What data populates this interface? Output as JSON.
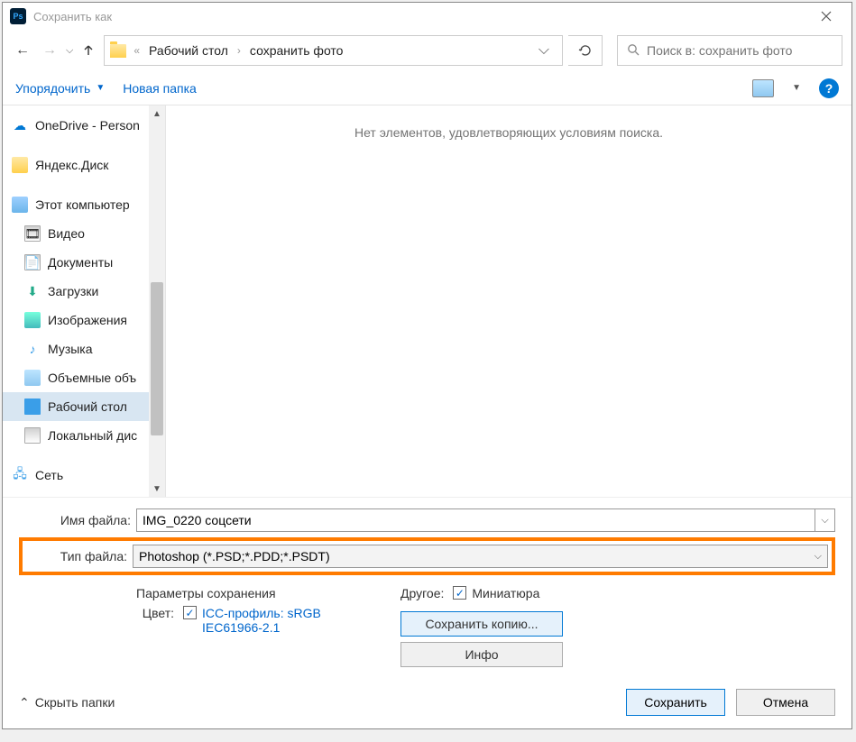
{
  "title": "Сохранить как",
  "app_icon_text": "Ps",
  "breadcrumb": {
    "prefix": "«",
    "seg1": "Рабочий стол",
    "seg2": "сохранить фото"
  },
  "search": {
    "placeholder": "Поиск в: сохранить фото"
  },
  "toolbar": {
    "organize": "Упорядочить",
    "newfolder": "Новая папка",
    "help_glyph": "?"
  },
  "sidebar": {
    "onedrive": "OneDrive - Person",
    "ydisk": "Яндекс.Диск",
    "thispc": "Этот компьютер",
    "video": "Видео",
    "docs": "Документы",
    "downloads": "Загрузки",
    "images": "Изображения",
    "music": "Музыка",
    "volumes": "Объемные объ",
    "desktop": "Рабочий стол",
    "localdisk": "Локальный дис",
    "network": "Сеть"
  },
  "main": {
    "empty": "Нет элементов, удовлетворяющих условиям поиска."
  },
  "fields": {
    "filename_label": "Имя файла:",
    "filename_value": "IMG_0220 соцсети",
    "filetype_label": "Тип файла:",
    "filetype_value": "Photoshop (*.PSD;*.PDD;*.PSDT)"
  },
  "options": {
    "save_params": "Параметры сохранения",
    "color_label": "Цвет:",
    "icc_profile": "ICC-профиль: sRGB IEC61966-2.1",
    "other_label": "Другое:",
    "thumbnail": "Миниатюра",
    "save_copy": "Сохранить копию...",
    "info": "Инфо"
  },
  "footer": {
    "hide_folders": "Скрыть папки",
    "save": "Сохранить",
    "cancel": "Отмена"
  }
}
